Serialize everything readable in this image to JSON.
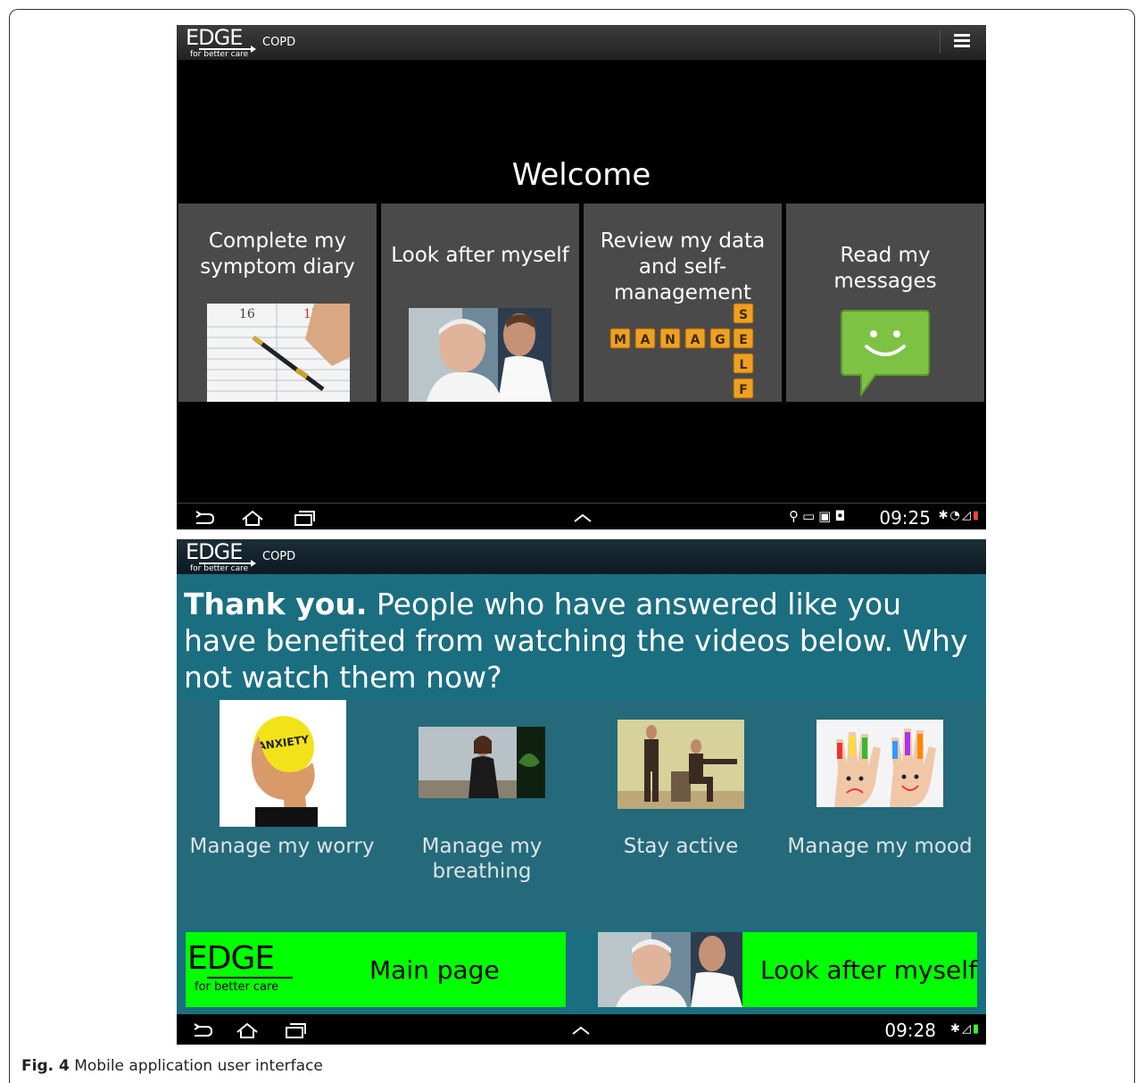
{
  "screen1": {
    "app": {
      "logo": "EDGE",
      "tagline": "for better care",
      "subtitle": "COPD"
    },
    "welcome": "Welcome",
    "tiles": [
      {
        "label": "Complete my symptom diary",
        "icon": "diary-pen-icon"
      },
      {
        "label": "Look after myself",
        "icon": "doctor-patient-photo"
      },
      {
        "label": "Review my data and self-management",
        "icon": "manage-self-tiles-icon"
      },
      {
        "label": "Read my messages",
        "icon": "message-smiley-icon"
      }
    ],
    "manage_letters": [
      "M",
      "A",
      "N",
      "A",
      "G",
      "E"
    ],
    "self_letters": [
      "S",
      "E",
      "L",
      "F"
    ],
    "clock": "09:25"
  },
  "screen2": {
    "app": {
      "logo": "EDGE",
      "tagline": "for better care",
      "subtitle": "COPD"
    },
    "message_bold": "Thank you.",
    "message": " People who have answered like you have benefited from watching the videos below. Why not watch them now?",
    "videos": [
      {
        "label": "Manage my worry",
        "icon": "anxiety-ball-photo"
      },
      {
        "label": "Manage my breathing",
        "icon": "woman-seated-photo"
      },
      {
        "label": "Stay active",
        "icon": "exercise-photo"
      },
      {
        "label": "Manage my mood",
        "icon": "painted-hands-photo"
      }
    ],
    "main_page": "Main page",
    "look_after": "Look after myself",
    "clock": "09:28"
  },
  "caption": {
    "bold": "Fig. 4",
    "text": " Mobile application user interface"
  },
  "colors": {
    "teal": "#1a6e80",
    "tile": "#4a4a4a",
    "green_button": "#00ff00",
    "manage_tile": "#f0a020"
  }
}
